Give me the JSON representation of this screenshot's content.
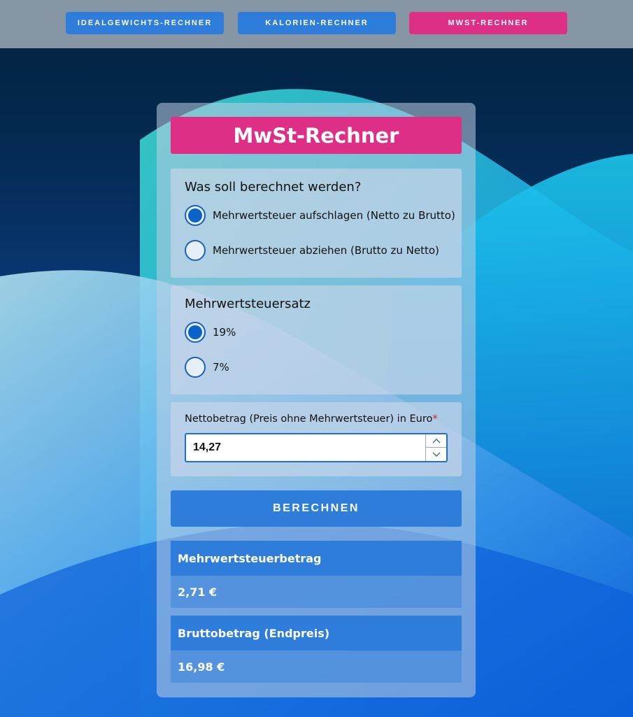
{
  "nav": {
    "items": [
      {
        "label": "IDEALGEWICHTS-RECHNER",
        "active": false
      },
      {
        "label": "KALORIEN-RECHNER",
        "active": false
      },
      {
        "label": "MWST-RECHNER",
        "active": true
      }
    ]
  },
  "colors": {
    "primary": "#2e7ddb",
    "accent": "#de2f86",
    "topbar": "#8796a5"
  },
  "calculator": {
    "title": "MwSt-Rechner",
    "mode": {
      "heading": "Was soll berechnet werden?",
      "options": [
        {
          "label": "Mehrwertsteuer aufschlagen (Netto zu Brutto)",
          "selected": true
        },
        {
          "label": "Mehrwertsteuer abziehen (Brutto zu Netto)",
          "selected": false
        }
      ]
    },
    "rate": {
      "heading": "Mehrwertsteuersatz",
      "options": [
        {
          "label": "19%",
          "selected": true
        },
        {
          "label": "7%",
          "selected": false
        }
      ]
    },
    "amount": {
      "label": "Nettobetrag (Preis ohne Mehrwertsteuer) in Euro",
      "required_mark": "*",
      "value": "14,27"
    },
    "button_label": "BERECHNEN",
    "results": [
      {
        "label": "Mehrwertsteuerbetrag",
        "value": "2,71 €"
      },
      {
        "label": "Bruttobetrag (Endpreis)",
        "value": "16,98 €"
      }
    ]
  }
}
